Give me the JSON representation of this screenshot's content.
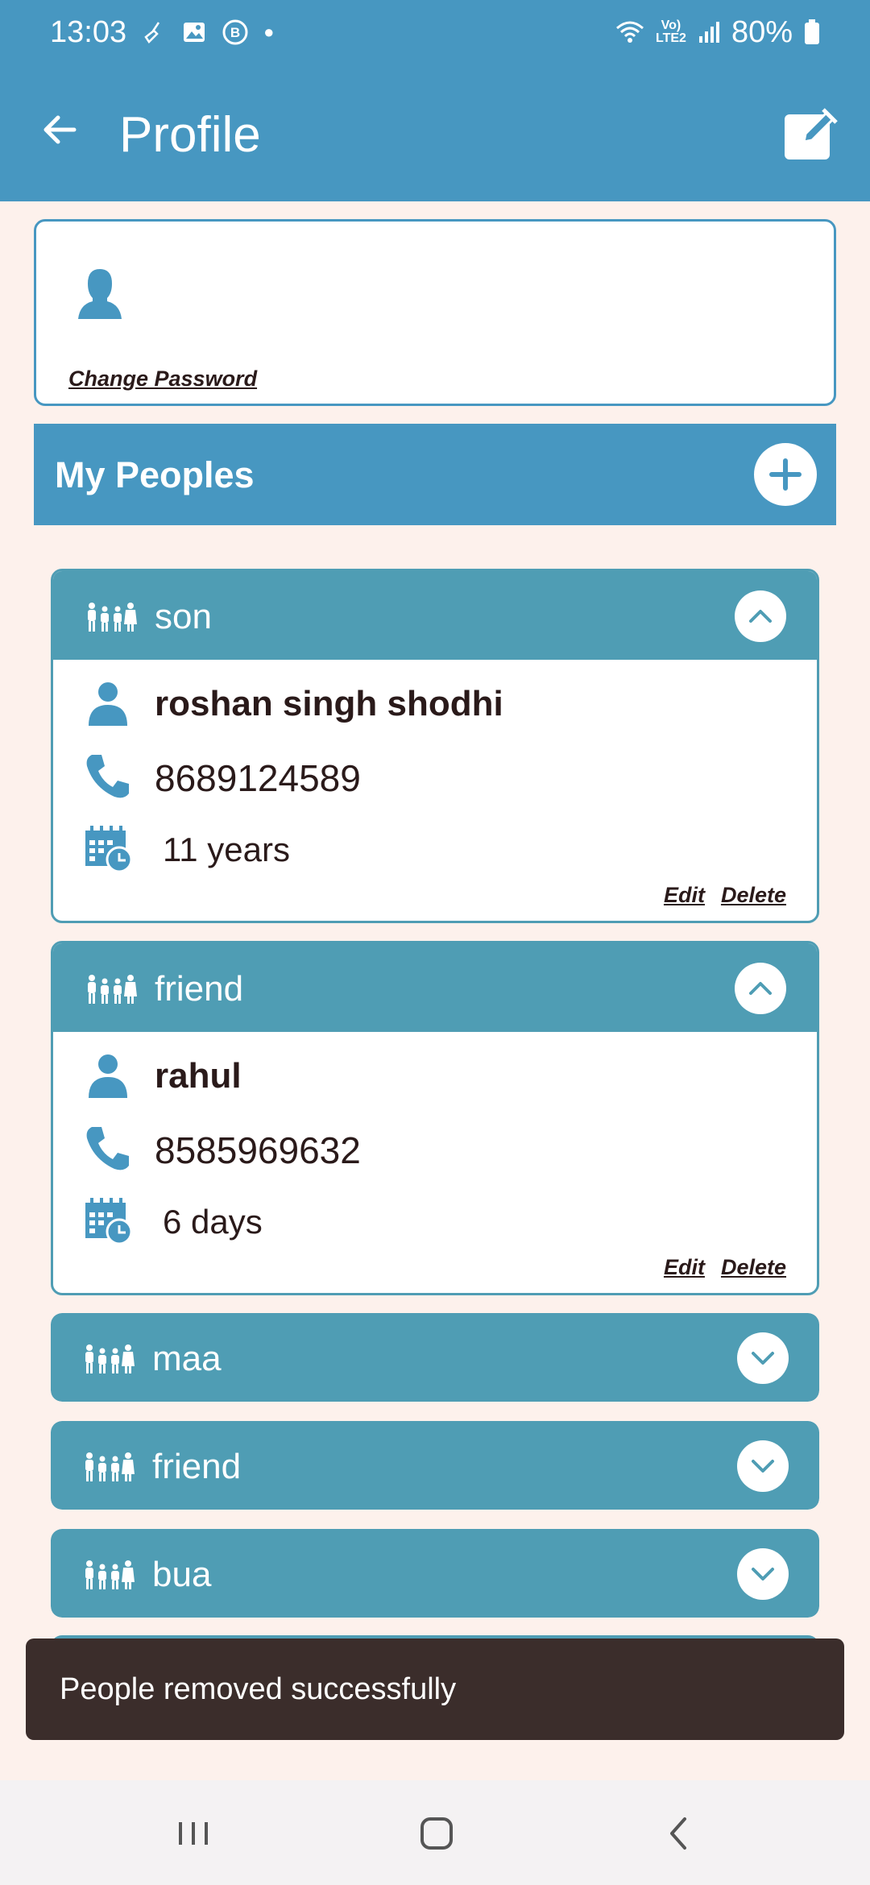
{
  "status_bar": {
    "time": "13:03",
    "battery": "80%",
    "lte_top": "Vo)",
    "lte_bottom": "LTE2",
    "icons": [
      "broom-icon",
      "gallery-icon",
      "b-badge-icon",
      "dot-icon",
      "wifi-icon",
      "lte-icon",
      "signal-icon",
      "battery-icon"
    ]
  },
  "app_bar": {
    "title": "Profile",
    "back_icon": "arrow-left-icon",
    "edit_icon": "edit-square-icon"
  },
  "profile": {
    "change_password": "Change Password"
  },
  "peoples": {
    "title": "My Peoples"
  },
  "groups": [
    {
      "name": "son",
      "expanded": true,
      "person": {
        "name": "roshan singh shodhi",
        "phone": "8689124589",
        "age": "11 years"
      },
      "edit": "Edit",
      "delete": "Delete"
    },
    {
      "name": "friend",
      "expanded": true,
      "person": {
        "name": "rahul",
        "phone": "8585969632",
        "age": "6 days"
      },
      "edit": "Edit",
      "delete": "Delete"
    },
    {
      "name": "maa",
      "expanded": false
    },
    {
      "name": "friend",
      "expanded": false
    },
    {
      "name": "bua",
      "expanded": false
    }
  ],
  "snackbar": {
    "message": "People removed successfully"
  },
  "colors": {
    "app_bar": "#4797c1",
    "group_header": "#4f9db4",
    "background": "#fdf1ec",
    "snackbar": "#3b2d2b"
  },
  "nav": {
    "icons": [
      "recents-icon",
      "home-icon",
      "back-icon"
    ]
  }
}
